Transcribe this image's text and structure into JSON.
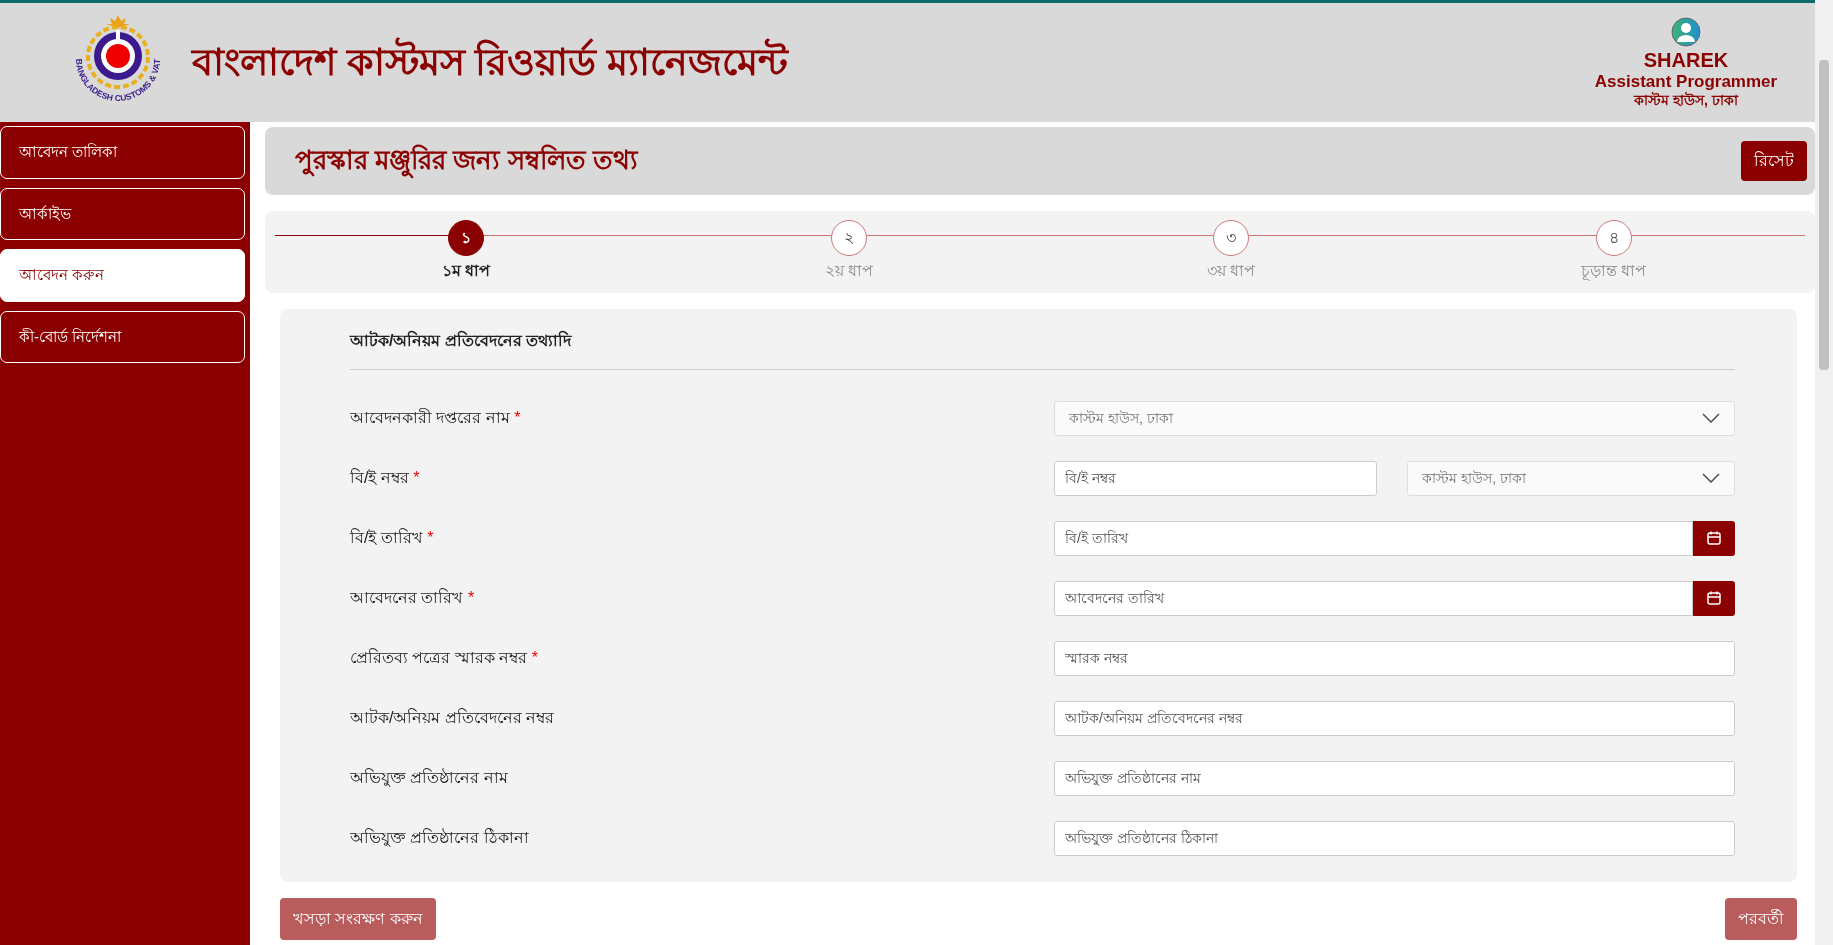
{
  "header": {
    "logo_text": "BANGLADESH CUSTOMS & VAT",
    "title": "বাংলাদেশ কাস্টমস রিওয়ার্ড ম্যানেজমেন্ট",
    "user": {
      "name": "SHAREK",
      "role": "Assistant Programmer",
      "office": "কাস্টম হাউস, ঢাকা"
    }
  },
  "sidebar": {
    "items": [
      {
        "label": "আবেদন তালিকা",
        "selected": false
      },
      {
        "label": "আর্কাইভ",
        "selected": false
      },
      {
        "label": "আবেদন করুন",
        "selected": true
      },
      {
        "label": "কী-বোর্ড নির্দেশনা",
        "selected": false
      }
    ]
  },
  "page_title": "পুরস্কার মঞ্জুরির জন্য সম্বলিত তথ্য",
  "reset_button": "রিসেট",
  "steps": [
    {
      "number": "১",
      "label": "১ম ধাপ",
      "selected": true
    },
    {
      "number": "২",
      "label": "২য় ধাপ",
      "selected": false
    },
    {
      "number": "৩",
      "label": "৩য় ধাপ",
      "selected": false
    },
    {
      "number": "৪",
      "label": "চূড়ান্ত ধাপ",
      "selected": false
    }
  ],
  "form": {
    "heading": "আটক/অনিয়ম প্রতিবেদনের তথ্যাদি",
    "required_mark": "*",
    "rows": [
      {
        "label": "আবেদনকারী দপ্তরের নাম",
        "required": true,
        "fields": [
          {
            "kind": "select",
            "value": "কাস্টম হাউস, ঢাকা"
          }
        ]
      },
      {
        "label": "বি/ই নম্বর",
        "required": true,
        "fields": [
          {
            "kind": "input",
            "placeholder": "বি/ই নম্বর"
          },
          {
            "kind": "select",
            "value": "কাস্টম হাউস, ঢাকা"
          }
        ]
      },
      {
        "label": "বি/ই তারিখ",
        "required": true,
        "fields": [
          {
            "kind": "date",
            "placeholder": "বি/ই তারিখ"
          }
        ]
      },
      {
        "label": "আবেদনের তারিখ",
        "required": true,
        "fields": [
          {
            "kind": "date",
            "placeholder": "আবেদনের তারিখ"
          }
        ]
      },
      {
        "label": "প্রেরিতব্য পত্রের স্মারক নম্বর",
        "required": true,
        "fields": [
          {
            "kind": "input",
            "placeholder": "স্মারক নম্বর"
          }
        ]
      },
      {
        "label": "আটক/অনিয়ম প্রতিবেদনের নম্বর",
        "required": false,
        "fields": [
          {
            "kind": "input",
            "placeholder": "আটক/অনিয়ম প্রতিবেদনের নম্বর"
          }
        ]
      },
      {
        "label": "অভিযুক্ত প্রতিষ্ঠানের নাম",
        "required": false,
        "fields": [
          {
            "kind": "input",
            "placeholder": "অভিযুক্ত প্রতিষ্ঠানের নাম"
          }
        ]
      },
      {
        "label": "অভিযুক্ত প্রতিষ্ঠানের ঠিকানা",
        "required": false,
        "fields": [
          {
            "kind": "input",
            "placeholder": "অভিযুক্ত প্রতিষ্ঠানের ঠিকানা"
          }
        ]
      }
    ]
  },
  "buttons": {
    "draft": "খসড়া সংরক্ষণ করুন",
    "next": "পরবর্তী"
  }
}
